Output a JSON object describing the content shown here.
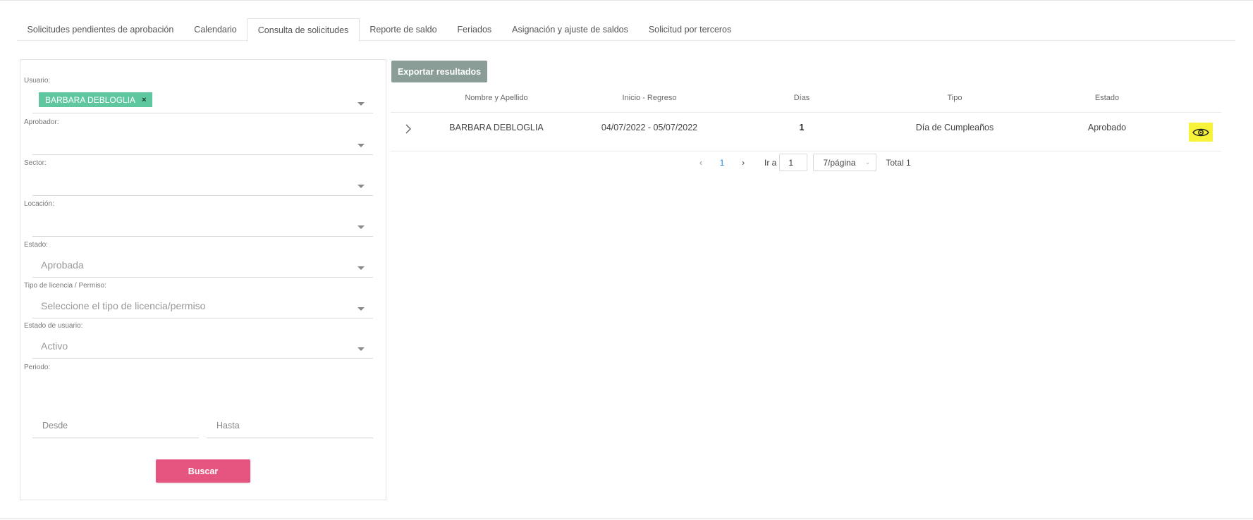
{
  "tabs": [
    {
      "label": "Solicitudes pendientes de aprobación",
      "active": false
    },
    {
      "label": "Calendario",
      "active": false
    },
    {
      "label": "Consulta de solicitudes",
      "active": true
    },
    {
      "label": "Reporte de saldo",
      "active": false
    },
    {
      "label": "Feriados",
      "active": false
    },
    {
      "label": "Asignación y ajuste de saldos",
      "active": false
    },
    {
      "label": "Solicitud por terceros",
      "active": false
    }
  ],
  "filters": {
    "usuario": {
      "label": "Usuario:",
      "chip": "BARBARA DEBLOGLIA",
      "chip_remove": "×"
    },
    "aprobador": {
      "label": "Aprobador:",
      "value": ""
    },
    "sector": {
      "label": "Sector:",
      "value": ""
    },
    "locacion": {
      "label": "Locación:",
      "value": ""
    },
    "estado": {
      "label": "Estado:",
      "value": "Aprobada"
    },
    "tipo": {
      "label": "Tipo de licencia / Permiso:",
      "placeholder": "Seleccione el tipo de licencia/permiso"
    },
    "estado_usuario": {
      "label": "Estado de usuario:",
      "value": "Activo"
    },
    "periodo": {
      "label": "Periodo:",
      "desde_placeholder": "Desde",
      "hasta_placeholder": "Hasta"
    },
    "search_label": "Buscar"
  },
  "results": {
    "export_label": "Exportar resultados",
    "columns": [
      "Nombre y Apellido",
      "Inicio - Regreso",
      "Días",
      "Tipo",
      "Estado"
    ],
    "rows": [
      {
        "nombre": "BARBARA DEBLOGLIA",
        "fechas": "04/07/2022 - 05/07/2022",
        "dias": "1",
        "tipo": "Día de Cumpleaños",
        "estado": "Aprobado"
      }
    ],
    "icons": {
      "expand": "chevron-right-icon",
      "view": "eye-icon"
    },
    "accent_view": "#f6f33a"
  },
  "pagination": {
    "current_page": "1",
    "goto_label": "Ir a",
    "goto_value": "1",
    "page_size": "7/página",
    "total": "Total 1"
  },
  "colors": {
    "chip": "#5ec7a0",
    "search_button": "#e5557f",
    "export_button": "#8a9d97",
    "active_page": "#1e88e5"
  }
}
